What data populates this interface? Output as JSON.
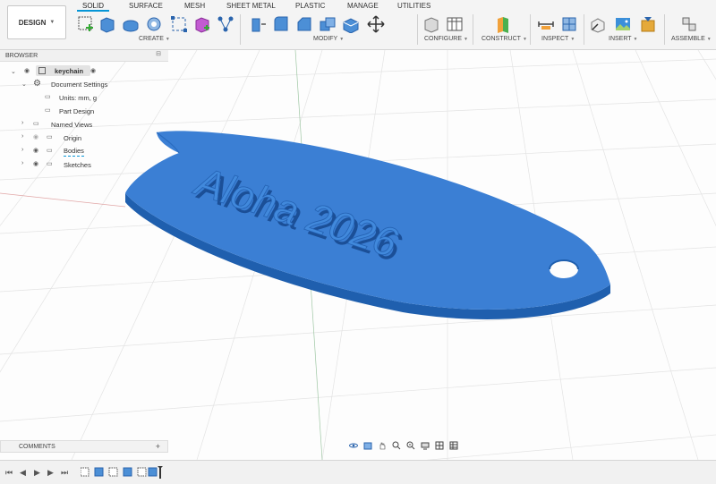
{
  "workspace": {
    "label": "DESIGN"
  },
  "tabs": [
    {
      "label": "SOLID",
      "active": true
    },
    {
      "label": "SURFACE"
    },
    {
      "label": "MESH"
    },
    {
      "label": "SHEET METAL"
    },
    {
      "label": "PLASTIC"
    },
    {
      "label": "MANAGE"
    },
    {
      "label": "UTILITIES"
    }
  ],
  "groups": [
    {
      "label": "CREATE"
    },
    {
      "label": "MODIFY"
    },
    {
      "label": "CONFIGURE"
    },
    {
      "label": "CONSTRUCT"
    },
    {
      "label": "INSPECT"
    },
    {
      "label": "INSERT"
    },
    {
      "label": "ASSEMBLE"
    }
  ],
  "browser": {
    "title": "BROWSER",
    "items": [
      {
        "label": "keychain"
      },
      {
        "label": "Document Settings"
      },
      {
        "label": "Units: mm, g"
      },
      {
        "label": "Part Design"
      },
      {
        "label": "Named Views"
      },
      {
        "label": "Origin"
      },
      {
        "label": "Bodies"
      },
      {
        "label": "Sketches"
      }
    ]
  },
  "model": {
    "text": "Aloha 2026"
  },
  "comments": {
    "label": "COMMENTS"
  },
  "colors": {
    "accent": "#0696d7",
    "body": "#3b7fd4",
    "body_dark": "#1f5fae",
    "grid": "#dcdcdc"
  }
}
